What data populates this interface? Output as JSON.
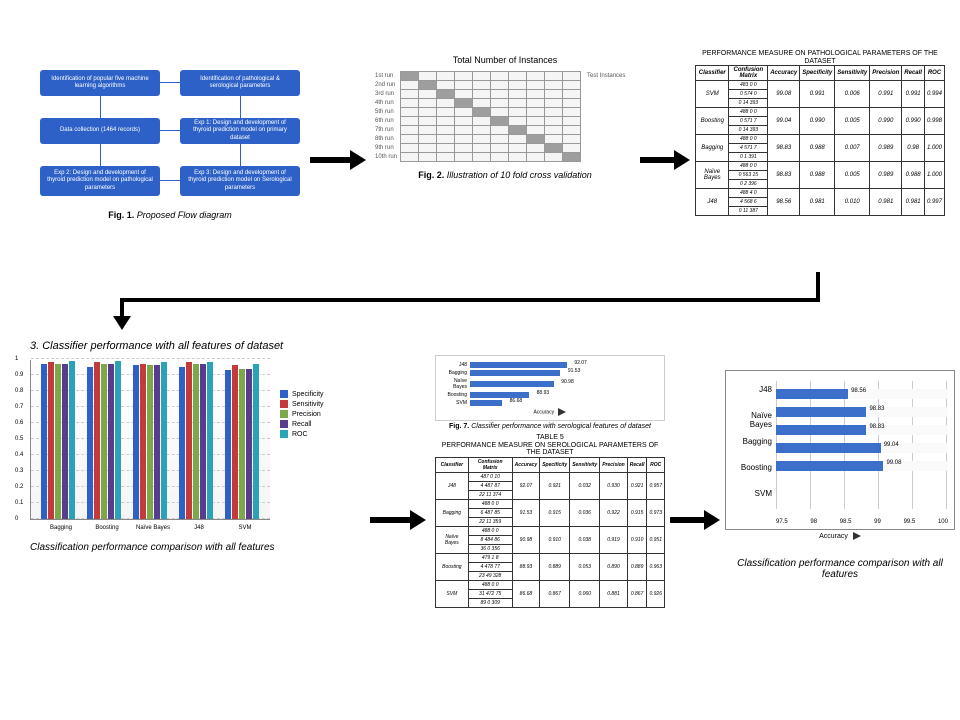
{
  "panel1": {
    "boxes": {
      "b1": "Identification of popular five machine learning algorithms",
      "b2": "Identification of pathological & serological parameters",
      "b3": "Data collection (1464 records)",
      "b4": "Exp 1: Design and development of thyroid prediction model on primary dataset",
      "b5": "Exp 2: Design and development of thyroid prediction model on pathological parameters",
      "b6": "Exp 3: Design and development of thyroid prediction model on Serological parameters"
    },
    "caption": "Fig. 1. Proposed Flow diagram"
  },
  "panel2": {
    "title": "Total Number of Instances",
    "runs": [
      "1st run",
      "2nd run",
      "3rd run",
      "4th run",
      "5th run",
      "6th run",
      "7th run",
      "8th run",
      "9th run",
      "10th run"
    ],
    "test_label": "Test Instances",
    "caption": "Fig. 2. Illustration of 10 fold cross validation"
  },
  "panel3": {
    "title": "PERFORMANCE MEASURE ON PATHOLOGICAL PARAMETERS OF THE DATASET",
    "headers": [
      "Classifier",
      "Confusion Matrix",
      "Accuracy",
      "Specificity",
      "Sensitivity",
      "Precision",
      "Recall",
      "ROC"
    ],
    "rows": [
      {
        "clf": "SVM",
        "cm": [
          [
            "483",
            "0",
            "0"
          ],
          [
            "0",
            "574",
            "0"
          ],
          [
            "0",
            "14",
            "393"
          ]
        ],
        "acc": "99.08",
        "spec": "0.991",
        "sens": "0.006",
        "prec": "0.991",
        "rec": "0.991",
        "roc": "0.994"
      },
      {
        "clf": "Boosting",
        "cm": [
          [
            "488",
            "0",
            "0"
          ],
          [
            "0",
            "571",
            "7"
          ],
          [
            "0",
            "14",
            "393"
          ]
        ],
        "acc": "99.04",
        "spec": "0.990",
        "sens": "0.005",
        "prec": "0.990",
        "rec": "0.990",
        "roc": "0.998"
      },
      {
        "clf": "Bagging",
        "cm": [
          [
            "488",
            "0",
            "0"
          ],
          [
            "4",
            "571",
            "7"
          ],
          [
            "0",
            "1",
            "391"
          ]
        ],
        "acc": "98.83",
        "spec": "0.988",
        "sens": "0.007",
        "prec": "0.989",
        "rec": "0.98",
        "roc": "1.000"
      },
      {
        "clf": "Naïve Bayes",
        "cm": [
          [
            "488",
            "0",
            "0"
          ],
          [
            "0",
            "563",
            "15"
          ],
          [
            "0",
            "2",
            "396"
          ]
        ],
        "acc": "98.83",
        "spec": "0.988",
        "sens": "0.005",
        "prec": "0.989",
        "rec": "0.988",
        "roc": "1.000"
      },
      {
        "clf": "J48",
        "cm": [
          [
            "488",
            "4",
            "0"
          ],
          [
            "4",
            "568",
            "6"
          ],
          [
            "0",
            "11",
            "387"
          ]
        ],
        "acc": "98.56",
        "spec": "0.981",
        "sens": "0.010",
        "prec": "0.981",
        "rec": "0.981",
        "roc": "0.997"
      }
    ]
  },
  "panel4": {
    "section_title": "3. Classifier performance with all features of dataset",
    "caption": "Classification performance comparison with all features",
    "legend": [
      "Specificity",
      "Sensitivity",
      "Precision",
      "Recall",
      "ROC"
    ],
    "colors": [
      "#2e61c7",
      "#c23a3a",
      "#7da84a",
      "#5a3c8e",
      "#2aa3b8"
    ],
    "yticks": [
      "0",
      "0.1",
      "0.2",
      "0.3",
      "0.4",
      "0.5",
      "0.6",
      "0.7",
      "0.8",
      "0.9",
      "1"
    ],
    "chart_data": {
      "type": "bar",
      "categories": [
        "Bagging",
        "Boosting",
        "Naïve Bayes",
        "J48",
        "SVM"
      ],
      "series": [
        {
          "name": "Specificity",
          "values": [
            0.97,
            0.95,
            0.96,
            0.95,
            0.93
          ]
        },
        {
          "name": "Sensitivity",
          "values": [
            0.98,
            0.98,
            0.97,
            0.98,
            0.96
          ]
        },
        {
          "name": "Precision",
          "values": [
            0.97,
            0.97,
            0.96,
            0.97,
            0.94
          ]
        },
        {
          "name": "Recall",
          "values": [
            0.97,
            0.97,
            0.96,
            0.97,
            0.94
          ]
        },
        {
          "name": "ROC",
          "values": [
            0.99,
            0.99,
            0.98,
            0.98,
            0.97
          ]
        }
      ],
      "ylim": [
        0,
        1
      ]
    }
  },
  "panel5": {
    "fig7_caption": "Fig. 7. Classifier performance with serological features of dataset",
    "fig7_chart": {
      "type": "bar",
      "orientation": "horizontal",
      "xlabel": "Accuracy",
      "xrange": [
        84,
        94
      ],
      "bars": [
        {
          "label": "SVM",
          "value": 86.68
        },
        {
          "label": "Boosting",
          "value": 88.93
        },
        {
          "label": "Naïve Bayes",
          "value": 90.98
        },
        {
          "label": "Bagging",
          "value": 91.53
        },
        {
          "label": "J48",
          "value": 92.07
        }
      ]
    },
    "table_title": "TABLE 5",
    "table_subtitle": "PERFORMANCE MEASURE ON SEROLOGICAL PARAMETERS OF THE DATASET",
    "headers": [
      "Classifier",
      "Confusion Matrix",
      "Accuracy",
      "Specificity",
      "Sensitivity",
      "Precision",
      "Recall",
      "ROC"
    ],
    "rows": [
      {
        "clf": "J48",
        "cm": [
          [
            "487",
            "0",
            "10"
          ],
          [
            "4",
            "487",
            "87"
          ],
          [
            "22",
            "11",
            "374"
          ]
        ],
        "acc": "92.07",
        "spec": "0.921",
        "sens": "0.032",
        "prec": "0.930",
        "rec": "0.921",
        "roc": "0.957"
      },
      {
        "clf": "Bagging",
        "cm": [
          [
            "488",
            "0",
            "0"
          ],
          [
            "6",
            "487",
            "85"
          ],
          [
            "22",
            "11",
            "359"
          ]
        ],
        "acc": "91.53",
        "spec": "0.915",
        "sens": "0.036",
        "prec": "0.922",
        "rec": "0.915",
        "roc": "0.973"
      },
      {
        "clf": "Naïve Bayes",
        "cm": [
          [
            "488",
            "0",
            "0"
          ],
          [
            "8",
            "484",
            "86"
          ],
          [
            "36",
            "0",
            "356"
          ]
        ],
        "acc": "90.98",
        "spec": "0.910",
        "sens": "0.038",
        "prec": "0.919",
        "rec": "0.910",
        "roc": "0.951"
      },
      {
        "clf": "Boosting",
        "cm": [
          [
            "479",
            "1",
            "8"
          ],
          [
            "4",
            "478",
            "77"
          ],
          [
            "23",
            "49",
            "328"
          ]
        ],
        "acc": "88.93",
        "spec": "0.889",
        "sens": "0.053",
        "prec": "0.890",
        "rec": "0.889",
        "roc": "0.963"
      },
      {
        "clf": "SVM",
        "cm": [
          [
            "488",
            "0",
            "0"
          ],
          [
            "31",
            "472",
            "75"
          ],
          [
            "89",
            "0",
            "309"
          ]
        ],
        "acc": "86.68",
        "spec": "0.867",
        "sens": "0.060",
        "prec": "0.881",
        "rec": "0.867",
        "roc": "0.926"
      }
    ]
  },
  "panel6": {
    "caption": "Classification performance comparison with all features",
    "xlabel": "Accuracy",
    "xticks": [
      "97.5",
      "98",
      "98.5",
      "99",
      "99.5",
      "100"
    ],
    "chart_data": {
      "type": "bar",
      "orientation": "horizontal",
      "categories": [
        "J48",
        "Naïve Bayes",
        "Bagging",
        "Boosting",
        "SVM"
      ],
      "values": [
        98.56,
        98.83,
        98.83,
        99.04,
        99.08
      ],
      "xlim": [
        97.5,
        100
      ]
    }
  }
}
